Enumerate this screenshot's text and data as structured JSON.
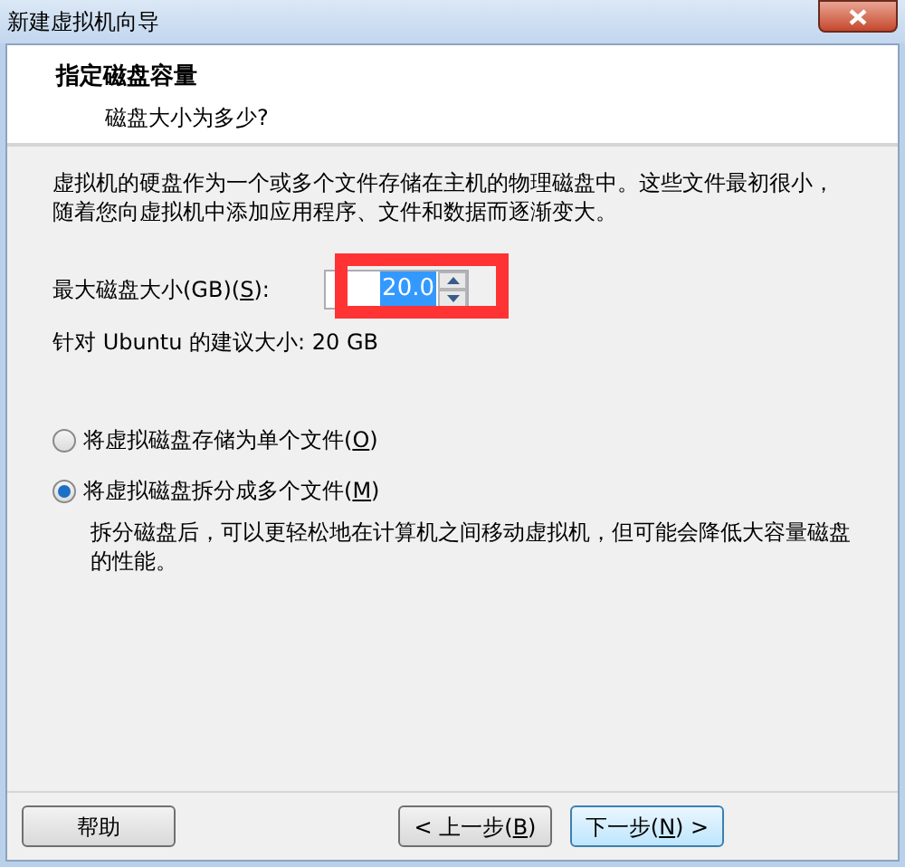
{
  "window": {
    "title": "新建虚拟机向导"
  },
  "header": {
    "title": "指定磁盘容量",
    "subtitle": "磁盘大小为多少?"
  },
  "intro": "虚拟机的硬盘作为一个或多个文件存储在主机的物理磁盘中。这些文件最初很小，随着您向虚拟机中添加应用程序、文件和数据而逐渐变大。",
  "size_field": {
    "label_before": "最大磁盘大小(GB)(",
    "access_key": "S",
    "label_after": "):",
    "value": "20.0"
  },
  "recommendation": "针对 Ubuntu 的建议大小: 20 GB",
  "options": [
    {
      "label_before": "将虚拟磁盘存储为单个文件(",
      "access_key": "O",
      "label_after": ")",
      "selected": false
    },
    {
      "label_before": "将虚拟磁盘拆分成多个文件(",
      "access_key": "M",
      "label_after": ")",
      "selected": true,
      "description": "拆分磁盘后，可以更轻松地在计算机之间移动虚拟机，但可能会降低大容量磁盘的性能。"
    }
  ],
  "buttons": [
    {
      "label_before": "帮助",
      "kind": "plain"
    },
    {
      "label_before": "< 上一步(",
      "access_key": "B",
      "label_after": ")",
      "kind": "plain"
    },
    {
      "label_before": "下一步(",
      "access_key": "N",
      "label_after": ") >",
      "kind": "default"
    }
  ]
}
